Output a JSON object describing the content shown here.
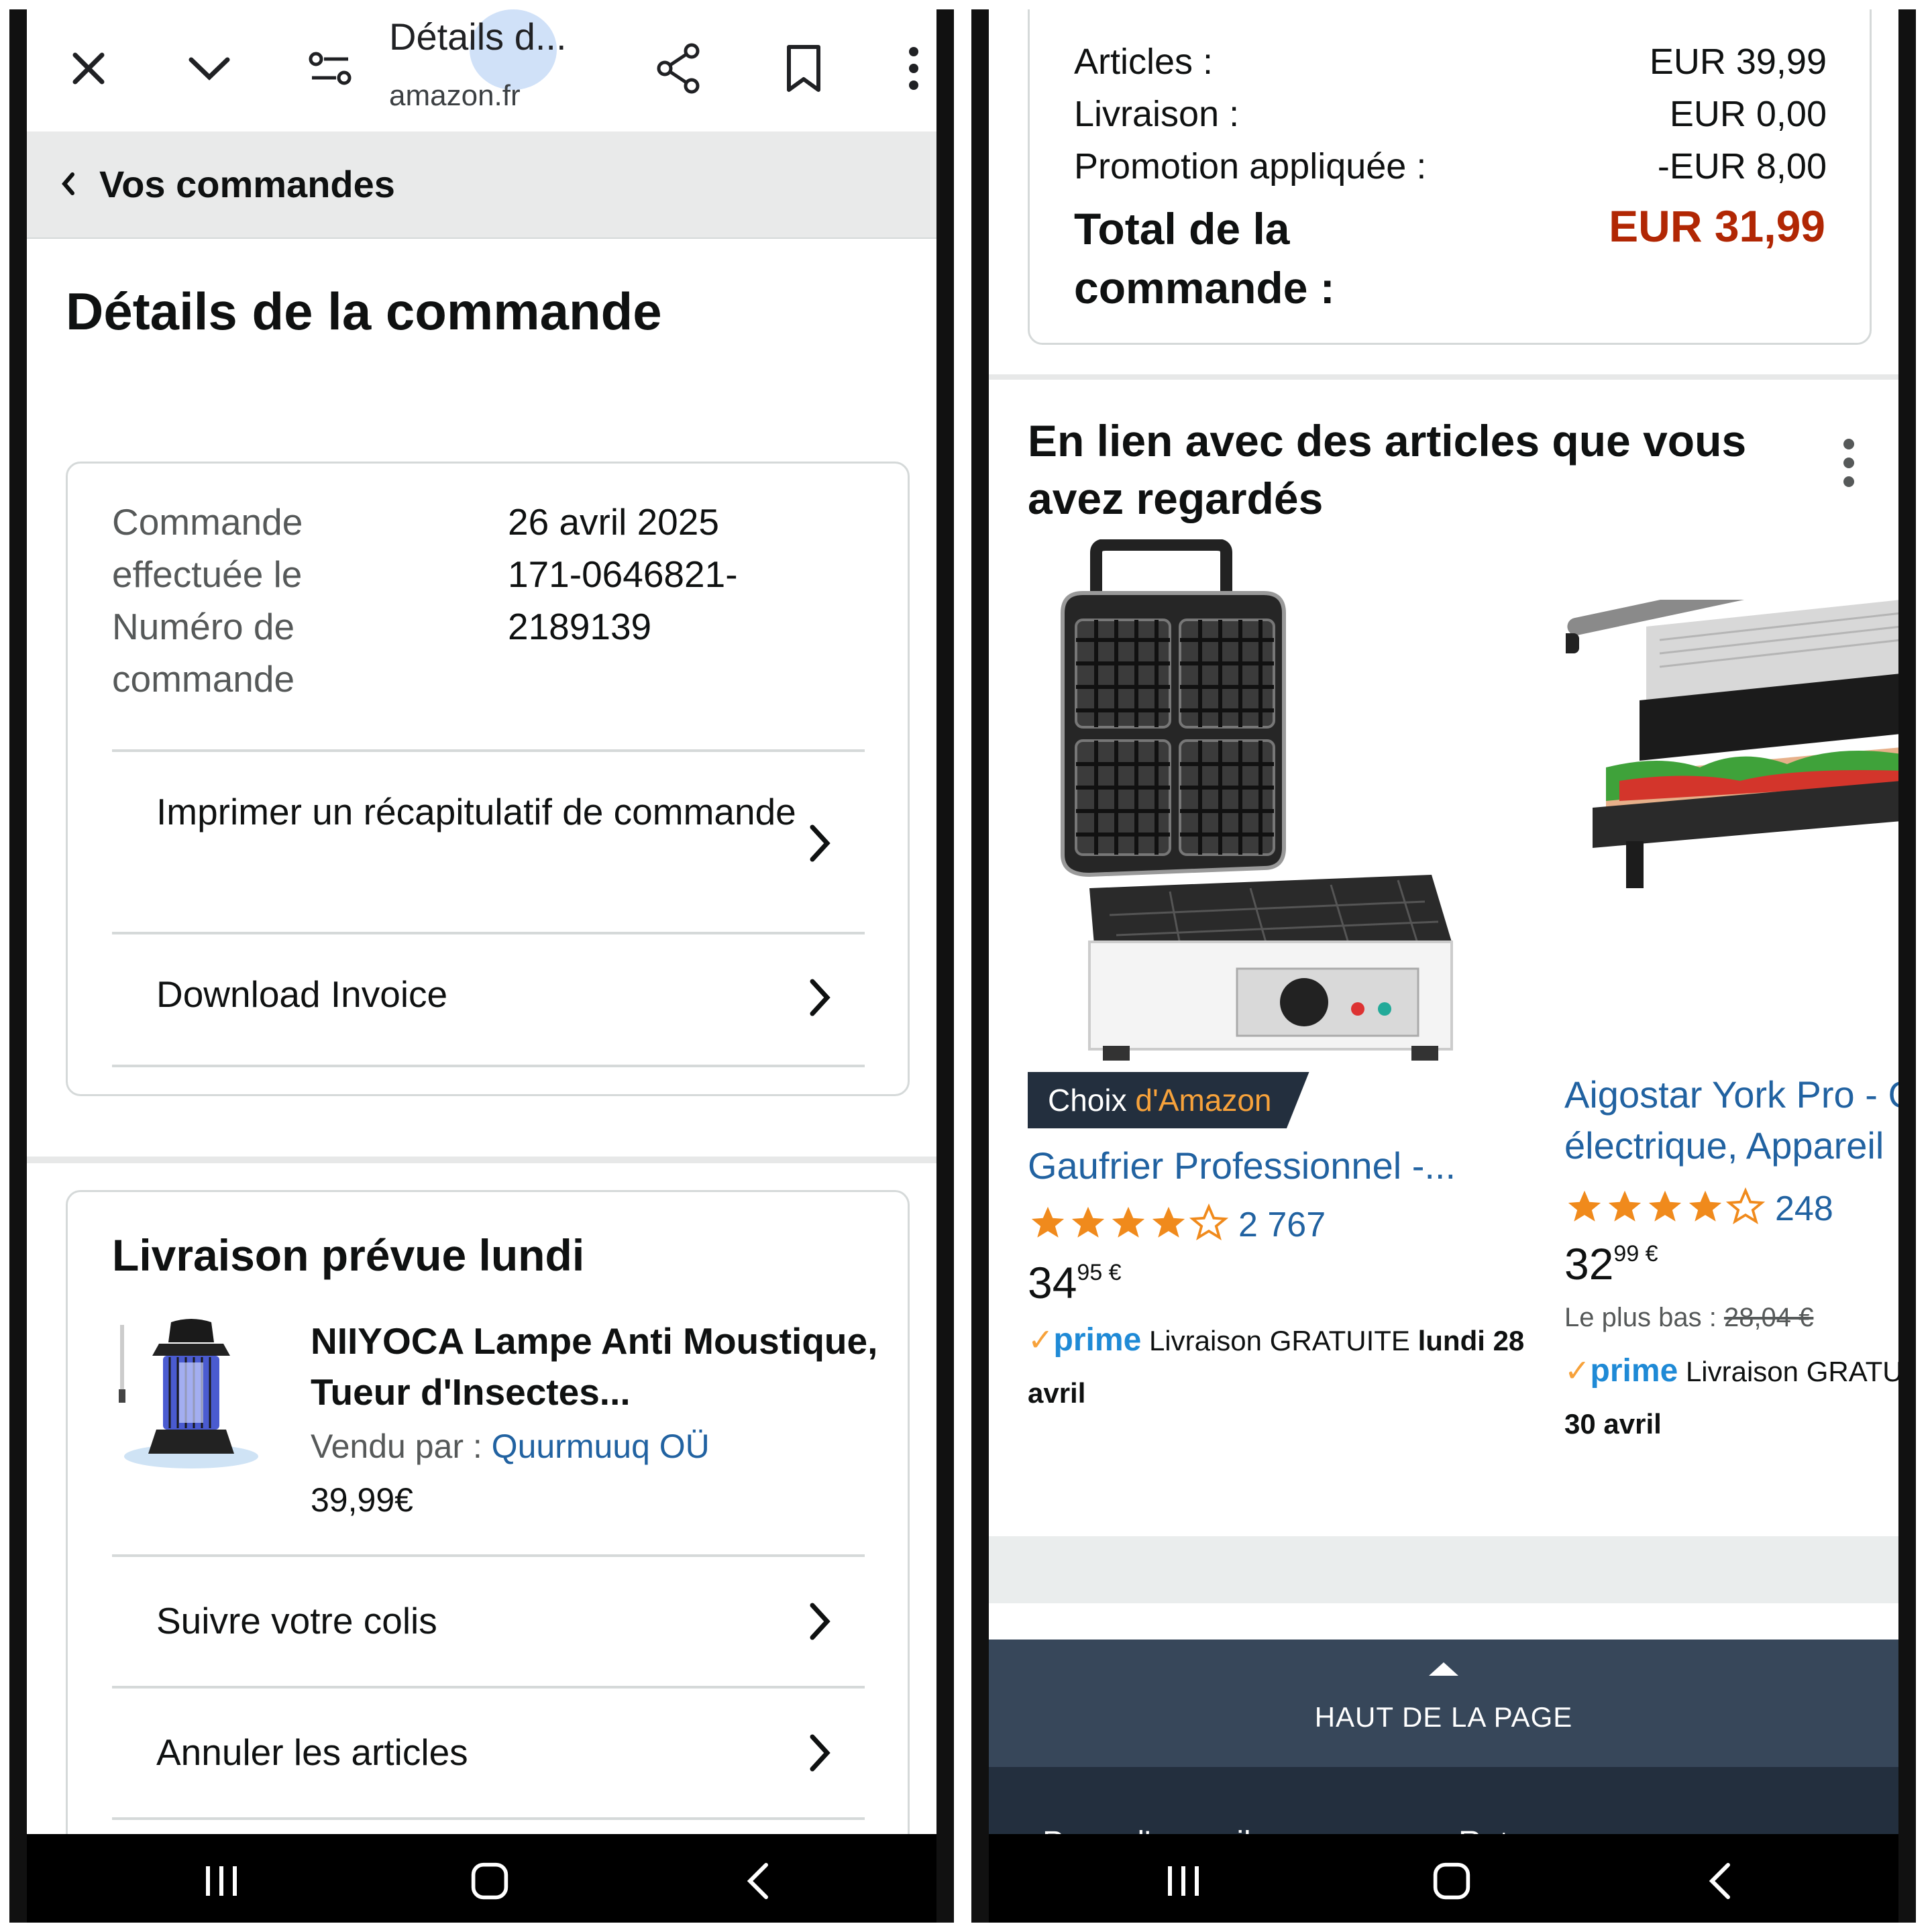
{
  "left": {
    "browser": {
      "title": "Détails d...",
      "url": "amazon.fr"
    },
    "breadcrumb": "Vos commandes",
    "page_title": "Détails de la commande",
    "order_info": {
      "label_lines": [
        "Commande",
        "effectuée le",
        "Numéro de",
        "commande"
      ],
      "value_lines": [
        "26 avril 2025",
        "171-0646821-",
        "2189139"
      ]
    },
    "actions": {
      "print_summary": "Imprimer un récapitulatif de commande",
      "download_invoice": "Download Invoice"
    },
    "delivery": {
      "title": "Livraison prévue lundi",
      "product_name": "NIIYOCA Lampe Anti Moustique, Tueur d'Insectes...",
      "sold_by_label": "Vendu par  :",
      "seller": "Quurmuuq OÜ",
      "price": "39,99€",
      "track": "Suivre votre colis",
      "cancel": "Annuler les articles"
    }
  },
  "right": {
    "summary": {
      "items_label": "Articles :",
      "items_value": "EUR 39,99",
      "shipping_label": "Livraison :",
      "shipping_value": "EUR 0,00",
      "promo_label": "Promotion appliquée :",
      "promo_value": "-EUR 8,00",
      "total_label": "Total de la commande :",
      "total_value": "EUR 31,99"
    },
    "related": {
      "title": "En lien avec des articles que vous avez regardés",
      "products": [
        {
          "badge_prefix": "Choix",
          "badge_suffix": "d'Amazon",
          "title": "Gaufrier Professionnel -...",
          "rating": 4,
          "review_count": "2 767",
          "price_whole": "34",
          "price_fraction": "95 €",
          "prime_label": "prime",
          "delivery_text": "Livraison GRATUITE",
          "delivery_date_1": "lundi 28",
          "delivery_date_2": "avril"
        },
        {
          "title_line1": "Aigostar York Pro - G",
          "title_line2": "électrique, Appareil",
          "rating": 4,
          "review_count": "248",
          "price_whole": "32",
          "price_fraction": "99 €",
          "lowest_label": "Le plus bas :",
          "lowest_price": "28,04 €",
          "prime_label": "prime",
          "delivery_text": "Livraison GRATUIT",
          "delivery_date": "30 avril"
        }
      ]
    },
    "footer": {
      "back_to_top": "HAUT DE LA PAGE",
      "link1": "Page d'accueil",
      "link2": "Retour"
    }
  },
  "colors": {
    "link": "#2162a1",
    "price_red": "#b12704",
    "footer_top": "#37475a",
    "footer_bottom": "#232f3e",
    "star": "#f08a1c",
    "badge_orange": "#f7a23b"
  },
  "icons": [
    "close-icon",
    "chevron-down-icon",
    "page-settings-icon",
    "share-icon",
    "bookmark-icon",
    "more-vert-icon",
    "chevron-left-icon",
    "chevron-right-icon",
    "star-icon",
    "recent-apps-icon",
    "home-icon",
    "back-icon"
  ]
}
